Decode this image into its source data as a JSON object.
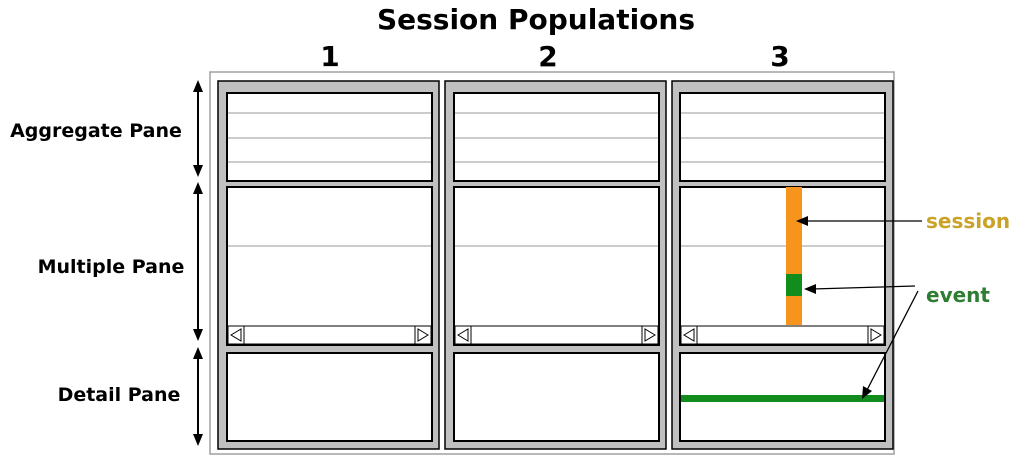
{
  "title": "Session Populations",
  "columns": [
    "1",
    "2",
    "3"
  ],
  "rows": [
    "Aggregate Pane",
    "Multiple Pane",
    "Detail Pane"
  ],
  "callouts": {
    "session": "session",
    "event": "event"
  },
  "colors": {
    "session": "#f7941d",
    "event": "#138c1e",
    "session_label": "#c9a227",
    "event_label": "#2e7d32",
    "frame": "#c0c0c0"
  }
}
